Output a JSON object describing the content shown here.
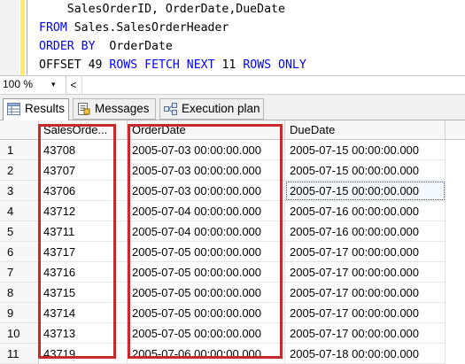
{
  "editor": {
    "lines": [
      {
        "parts": [
          {
            "t": "    SalesOrderID, OrderDate,DueDate",
            "c": ""
          }
        ]
      },
      {
        "parts": [
          {
            "t": "FROM",
            "c": "kw"
          },
          {
            "t": " Sales.SalesOrderHeader",
            "c": ""
          }
        ]
      },
      {
        "parts": [
          {
            "t": "ORDER BY",
            "c": "kw"
          },
          {
            "t": "  OrderDate",
            "c": ""
          }
        ]
      },
      {
        "parts": [
          {
            "t": "OFFSET",
            "c": ""
          },
          {
            "t": " 49 ",
            "c": ""
          },
          {
            "t": "ROWS",
            "c": "kw"
          },
          {
            "t": " ",
            "c": ""
          },
          {
            "t": "FETCH",
            "c": "kw"
          },
          {
            "t": " ",
            "c": ""
          },
          {
            "t": "NEXT",
            "c": "kw"
          },
          {
            "t": " 11 ",
            "c": ""
          },
          {
            "t": "ROWS",
            "c": "kw"
          },
          {
            "t": " ",
            "c": ""
          },
          {
            "t": "ONLY",
            "c": "kw"
          }
        ]
      }
    ]
  },
  "zoom": {
    "value": "100 %"
  },
  "tabs": [
    {
      "label": "Results",
      "icon": "results-grid-icon",
      "active": true
    },
    {
      "label": "Messages",
      "icon": "messages-icon",
      "active": false
    },
    {
      "label": "Execution plan",
      "icon": "execution-plan-icon",
      "active": false
    }
  ],
  "grid": {
    "columns": [
      "",
      "SalesOrde...",
      "OrderDate",
      "DueDate"
    ],
    "rows": [
      [
        "1",
        "43708",
        "2005-07-03 00:00:00.000",
        "2005-07-15 00:00:00.000"
      ],
      [
        "2",
        "43707",
        "2005-07-03 00:00:00.000",
        "2005-07-15 00:00:00.000"
      ],
      [
        "3",
        "43706",
        "2005-07-03 00:00:00.000",
        "2005-07-15 00:00:00.000"
      ],
      [
        "4",
        "43712",
        "2005-07-04 00:00:00.000",
        "2005-07-16 00:00:00.000"
      ],
      [
        "5",
        "43711",
        "2005-07-04 00:00:00.000",
        "2005-07-16 00:00:00.000"
      ],
      [
        "6",
        "43717",
        "2005-07-05 00:00:00.000",
        "2005-07-17 00:00:00.000"
      ],
      [
        "7",
        "43716",
        "2005-07-05 00:00:00.000",
        "2005-07-17 00:00:00.000"
      ],
      [
        "8",
        "43715",
        "2005-07-05 00:00:00.000",
        "2005-07-17 00:00:00.000"
      ],
      [
        "9",
        "43714",
        "2005-07-05 00:00:00.000",
        "2005-07-17 00:00:00.000"
      ],
      [
        "10",
        "43713",
        "2005-07-05 00:00:00.000",
        "2005-07-17 00:00:00.000"
      ],
      [
        "11",
        "43719",
        "2005-07-06 00:00:00.000",
        "2005-07-18 00:00:00.000"
      ]
    ],
    "selected_cell": {
      "row": 3,
      "column": 4
    }
  },
  "colors": {
    "keyword": "#0000ff",
    "highlight_box": "#c62a2f",
    "change_bar": "#ffee62"
  }
}
